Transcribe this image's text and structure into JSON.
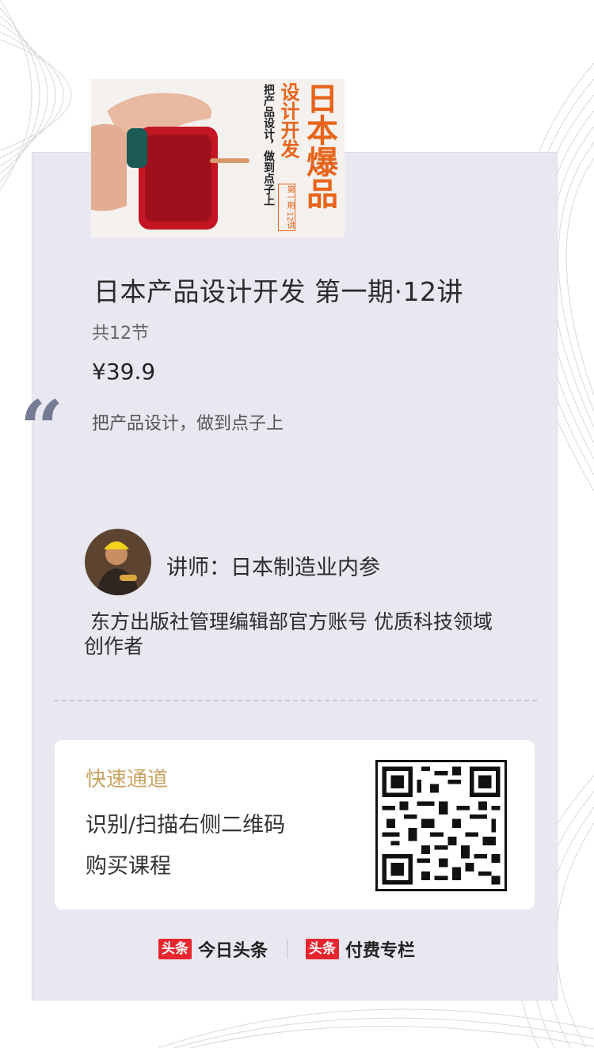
{
  "course": {
    "cover_text": {
      "headline": "日本爆品",
      "subhead": "设计开发",
      "tagline": "把产品设计，做到点子上",
      "issue": "第一期·12讲"
    },
    "title": "日本产品设计开发 第一期·12讲",
    "lessons": "共12节",
    "price": "¥39.9",
    "quote_mark": "“",
    "subtitle": "把产品设计，做到点子上"
  },
  "lecturer": {
    "label": "讲师：",
    "name": "日本制造业内参",
    "bio": "东方出版社管理编辑部官方账号 优质科技领域创作者"
  },
  "quick_access": {
    "title": "快速通道",
    "line1": "识别/扫描右侧二维码",
    "line2": "购买课程"
  },
  "footer": {
    "brand1_logo": "头条",
    "brand1_text": "今日头条",
    "brand2_logo": "头条",
    "brand2_text": "付费专栏"
  },
  "colors": {
    "card_bg": "#e9e8f1",
    "accent_gold": "#c9a463",
    "brand_red": "#e8262f",
    "quote_gray": "#747b93"
  }
}
